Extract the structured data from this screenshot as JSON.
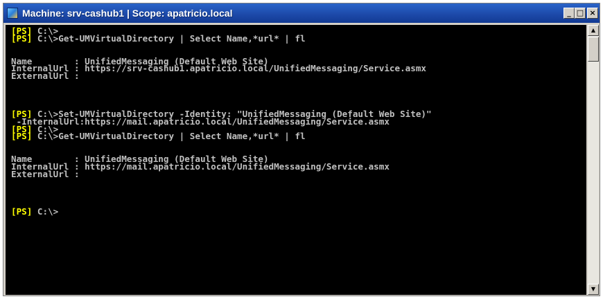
{
  "window": {
    "title": "Machine: srv-cashub1 | Scope: apatricio.local",
    "icon": "powershell-app-icon",
    "controls": {
      "minimize": "_",
      "maximize": "□",
      "close": "×"
    }
  },
  "colors": {
    "console_bg": "#000000",
    "console_text": "#c0c0c0",
    "prompt": "#ffff00",
    "titlebar": "#1c48a8"
  },
  "console": {
    "lines": [
      {
        "prompt": "[PS]",
        "text": " C:\\>"
      },
      {
        "prompt": "[PS]",
        "text": " C:\\>Get-UMVirtualDirectory | Select Name,*url* | fl"
      },
      {
        "prompt": "",
        "text": ""
      },
      {
        "prompt": "",
        "text": ""
      },
      {
        "prompt": "",
        "text": "Name        : UnifiedMessaging (Default Web Site)"
      },
      {
        "prompt": "",
        "text": "InternalUrl : https://srv-cashub1.apatricio.local/UnifiedMessaging/Service.asmx"
      },
      {
        "prompt": "",
        "text": "ExternalUrl :"
      },
      {
        "prompt": "",
        "text": ""
      },
      {
        "prompt": "",
        "text": ""
      },
      {
        "prompt": "",
        "text": ""
      },
      {
        "prompt": "",
        "text": ""
      },
      {
        "prompt": "[PS]",
        "text": " C:\\>Set-UMVirtualDirectory -Identity: \"UnifiedMessaging (Default Web Site)\""
      },
      {
        "prompt": "",
        "text": " -InternalUrl:https://mail.apatricio.local/UnifiedMessaging/Service.asmx"
      },
      {
        "prompt": "[PS]",
        "text": " C:\\>"
      },
      {
        "prompt": "[PS]",
        "text": " C:\\>Get-UMVirtualDirectory | Select Name,*url* | fl"
      },
      {
        "prompt": "",
        "text": ""
      },
      {
        "prompt": "",
        "text": ""
      },
      {
        "prompt": "",
        "text": "Name        : UnifiedMessaging (Default Web Site)"
      },
      {
        "prompt": "",
        "text": "InternalUrl : https://mail.apatricio.local/UnifiedMessaging/Service.asmx"
      },
      {
        "prompt": "",
        "text": "ExternalUrl :"
      },
      {
        "prompt": "",
        "text": ""
      },
      {
        "prompt": "",
        "text": ""
      },
      {
        "prompt": "",
        "text": ""
      },
      {
        "prompt": "",
        "text": ""
      },
      {
        "prompt": "[PS]",
        "text": " C:\\>"
      }
    ]
  },
  "scrollbar": {
    "up_arrow": "▲",
    "down_arrow": "▼"
  }
}
